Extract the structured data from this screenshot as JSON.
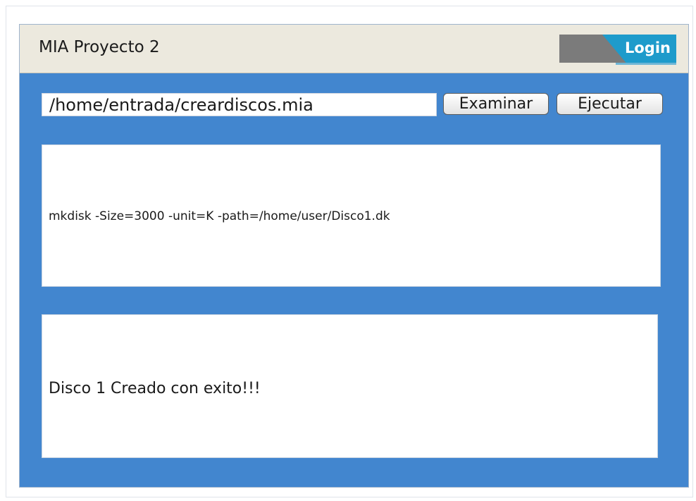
{
  "app": {
    "title": "MIA Proyecto 2",
    "login_label": "Login"
  },
  "toolbar": {
    "path_value": "/home/entrada/creardiscos.mia",
    "browse_label": "Examinar",
    "run_label": "Ejecutar"
  },
  "command_area": {
    "text": "mkdisk -Size=3000 -unit=K -path=/home/user/Disco1.dk"
  },
  "output_area": {
    "text": "Disco 1 Creado con exito!!!"
  },
  "colors": {
    "window_background": "#4286cf",
    "title_bar": "#ece9de",
    "login_accent": "#1e9bcb",
    "login_gray": "#7b7b7b"
  }
}
